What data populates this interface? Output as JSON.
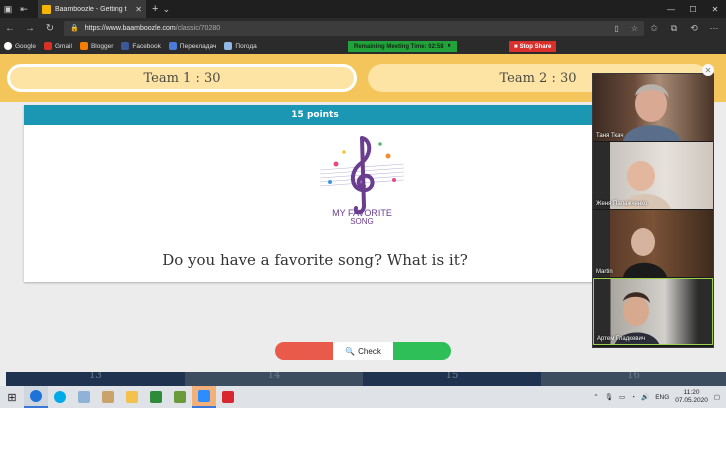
{
  "browser": {
    "tab_title": "Baamboozle - Getting t",
    "url_host": "https://www.baamboozle.com",
    "url_path": "/classic/70280",
    "bookmarks": [
      "Google",
      "Gmail",
      "Blogger",
      "Facebook",
      "Перекладач",
      "Погода"
    ]
  },
  "meeting": {
    "remaining_label": "Remaining Meeting Time: 02:58",
    "stop_share_label": "Stop Share"
  },
  "game": {
    "team1_label": "Team 1 :  30",
    "team2_label": "Team 2 :  30",
    "points_label": "15 points",
    "image_caption_line1": "MY FAVORITE",
    "image_caption_line2": "SONG",
    "question": "Do you have a favorite song? What is it?",
    "check_label": "Check",
    "tiles": [
      "13",
      "14",
      "15",
      "16"
    ]
  },
  "participants": [
    {
      "name": "Таня Ткач"
    },
    {
      "name": "Женя Палажченко"
    },
    {
      "name": "Martin"
    },
    {
      "name": "Артем Гладкевич"
    }
  ],
  "taskbar": {
    "lang": "ENG",
    "time": "11:20",
    "date": "07.05.2020"
  },
  "colors": {
    "team_bar": "#f3c55a",
    "points_header": "#1b97b3",
    "check_left": "#ea5a4a",
    "check_right": "#2fbf58"
  }
}
